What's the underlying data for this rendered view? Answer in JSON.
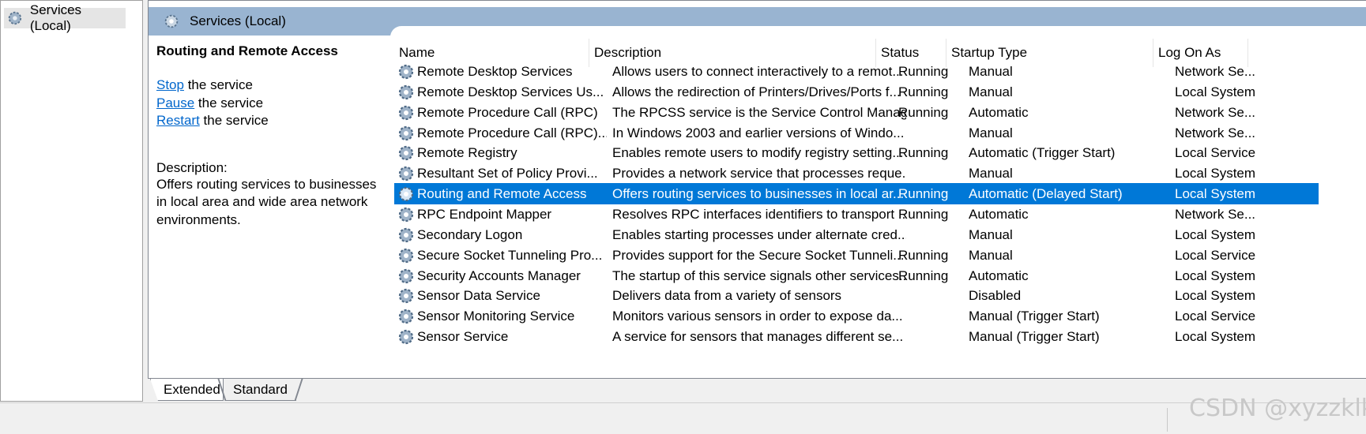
{
  "tree": {
    "item_label": "Services (Local)"
  },
  "main": {
    "title": "Services (Local)"
  },
  "detail": {
    "service_name": "Routing and Remote Access",
    "actions": [
      {
        "link": "Stop",
        "rest": " the service"
      },
      {
        "link": "Pause",
        "rest": " the service"
      },
      {
        "link": "Restart",
        "rest": " the service"
      }
    ],
    "description_header": "Description:",
    "description_text": "Offers routing services to businesses in local area and wide area network environments."
  },
  "columns": [
    "Name",
    "Description",
    "Status",
    "Startup Type",
    "Log On As"
  ],
  "rows": [
    {
      "name": "Remote Desktop Services",
      "desc": "Allows users to connect interactively to a remot...",
      "status": "Running",
      "startup": "Manual",
      "logon": "Network Se..."
    },
    {
      "name": "Remote Desktop Services Us...",
      "desc": "Allows the redirection of Printers/Drives/Ports f...",
      "status": "Running",
      "startup": "Manual",
      "logon": "Local System"
    },
    {
      "name": "Remote Procedure Call (RPC)",
      "desc": "The RPCSS service is the Service Control Manag...",
      "status": "Running",
      "startup": "Automatic",
      "logon": "Network Se..."
    },
    {
      "name": "Remote Procedure Call (RPC)...",
      "desc": "In Windows 2003 and earlier versions of Windo...",
      "status": "",
      "startup": "Manual",
      "logon": "Network Se..."
    },
    {
      "name": "Remote Registry",
      "desc": "Enables remote users to modify registry setting...",
      "status": "Running",
      "startup": "Automatic (Trigger Start)",
      "logon": "Local Service"
    },
    {
      "name": "Resultant Set of Policy Provi...",
      "desc": "Provides a network service that processes reque...",
      "status": "",
      "startup": "Manual",
      "logon": "Local System"
    },
    {
      "name": "Routing and Remote Access",
      "desc": "Offers routing services to businesses in local ar...",
      "status": "Running",
      "startup": "Automatic (Delayed Start)",
      "logon": "Local System",
      "selected": true
    },
    {
      "name": "RPC Endpoint Mapper",
      "desc": "Resolves RPC interfaces identifiers to transport ...",
      "status": "Running",
      "startup": "Automatic",
      "logon": "Network Se..."
    },
    {
      "name": "Secondary Logon",
      "desc": "Enables starting processes under alternate cred...",
      "status": "",
      "startup": "Manual",
      "logon": "Local System"
    },
    {
      "name": "Secure Socket Tunneling Pro...",
      "desc": "Provides support for the Secure Socket Tunneli...",
      "status": "Running",
      "startup": "Manual",
      "logon": "Local Service"
    },
    {
      "name": "Security Accounts Manager",
      "desc": "The startup of this service signals other services...",
      "status": "Running",
      "startup": "Automatic",
      "logon": "Local System"
    },
    {
      "name": "Sensor Data Service",
      "desc": "Delivers data from a variety of sensors",
      "status": "",
      "startup": "Disabled",
      "logon": "Local System"
    },
    {
      "name": "Sensor Monitoring Service",
      "desc": "Monitors various sensors in order to expose da...",
      "status": "",
      "startup": "Manual (Trigger Start)",
      "logon": "Local Service"
    },
    {
      "name": "Sensor Service",
      "desc": "A service for sensors that manages different se...",
      "status": "",
      "startup": "Manual (Trigger Start)",
      "logon": "Local System"
    }
  ],
  "tabs": [
    "Extended",
    "Standard"
  ],
  "watermark": "CSDN @xyzzklk",
  "icons": {
    "service": "gear-icon",
    "tree": "services-gear-icon"
  },
  "colors": {
    "selection": "#0078d7",
    "header": "#99b4d1",
    "link": "#0066cc"
  }
}
